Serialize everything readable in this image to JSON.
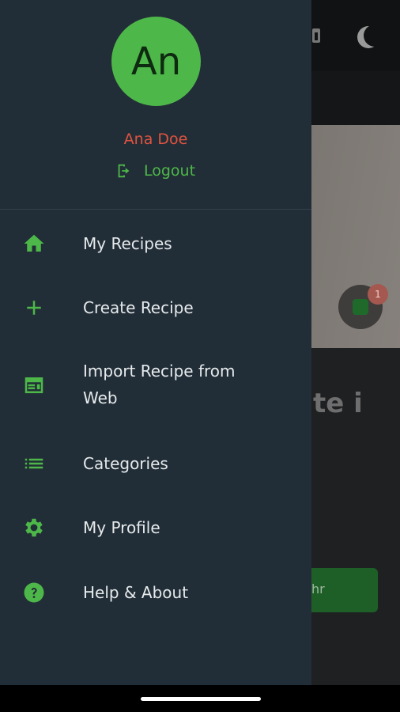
{
  "profile": {
    "avatar_initials": "An",
    "name": "Ana Doe",
    "logout_label": "Logout"
  },
  "menu": {
    "items": [
      {
        "label": "My Recipes",
        "icon": "home-icon"
      },
      {
        "label": "Create Recipe",
        "icon": "plus-icon"
      },
      {
        "label": "Import Recipe from Web",
        "icon": "web-import-icon"
      },
      {
        "label": "Categories",
        "icon": "list-icon"
      },
      {
        "label": "My Profile",
        "icon": "gear-icon"
      },
      {
        "label": "Help & About",
        "icon": "help-icon"
      }
    ]
  },
  "background": {
    "badge_count": "1",
    "heading_fragment": "te i",
    "button_fragment": "hr"
  },
  "colors": {
    "accent": "#4db849",
    "user_name": "#e0533f",
    "drawer_bg": "#222e37"
  }
}
